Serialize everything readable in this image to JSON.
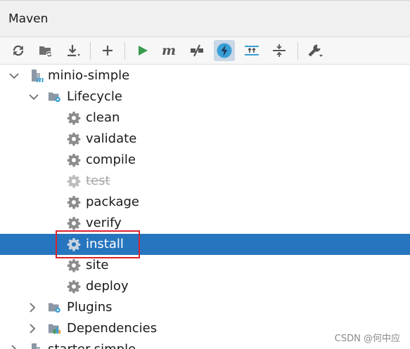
{
  "panel": {
    "title": "Maven"
  },
  "toolbar": {
    "buttons": [
      {
        "icon": "reload-icon",
        "label": "Reload All Maven Projects"
      },
      {
        "icon": "generate-sources-icon",
        "label": "Generate Sources"
      },
      {
        "icon": "download-icon",
        "label": "Download Sources"
      },
      {
        "icon": "add-icon",
        "label": "Add Maven Projects"
      },
      {
        "icon": "run-icon",
        "label": "Run Maven Build"
      },
      {
        "icon": "maven-goal-icon",
        "label": "Execute Maven Goal"
      },
      {
        "icon": "toggle-offline-icon",
        "label": "Toggle Offline Mode"
      },
      {
        "icon": "skip-tests-icon",
        "label": "Toggle Skip Tests Mode",
        "active": true
      },
      {
        "icon": "show-dependencies-icon",
        "label": "Show Dependencies"
      },
      {
        "icon": "collapse-all-icon",
        "label": "Collapse All"
      },
      {
        "icon": "settings-wrench-icon",
        "label": "Maven Settings"
      }
    ]
  },
  "tree": {
    "project1": "minio-simple",
    "lifecycle": "Lifecycle",
    "goals": [
      {
        "label": "clean",
        "disabled": false,
        "selected": false
      },
      {
        "label": "validate",
        "disabled": false,
        "selected": false
      },
      {
        "label": "compile",
        "disabled": false,
        "selected": false
      },
      {
        "label": "test",
        "disabled": true,
        "selected": false
      },
      {
        "label": "package",
        "disabled": false,
        "selected": false
      },
      {
        "label": "verify",
        "disabled": false,
        "selected": false
      },
      {
        "label": "install",
        "disabled": false,
        "selected": true
      },
      {
        "label": "site",
        "disabled": false,
        "selected": false
      },
      {
        "label": "deploy",
        "disabled": false,
        "selected": false
      }
    ],
    "plugins": "Plugins",
    "dependencies": "Dependencies",
    "project2": "starter-simple"
  },
  "watermark": "CSDN @何中应",
  "colors": {
    "selection": "#2675bf",
    "highlight_border": "#d9232d",
    "run_green": "#3a9b4d",
    "goal_gear": "#8c8c8c",
    "folder_icon": "#8c97a5",
    "accent_blue": "#389fd6"
  }
}
